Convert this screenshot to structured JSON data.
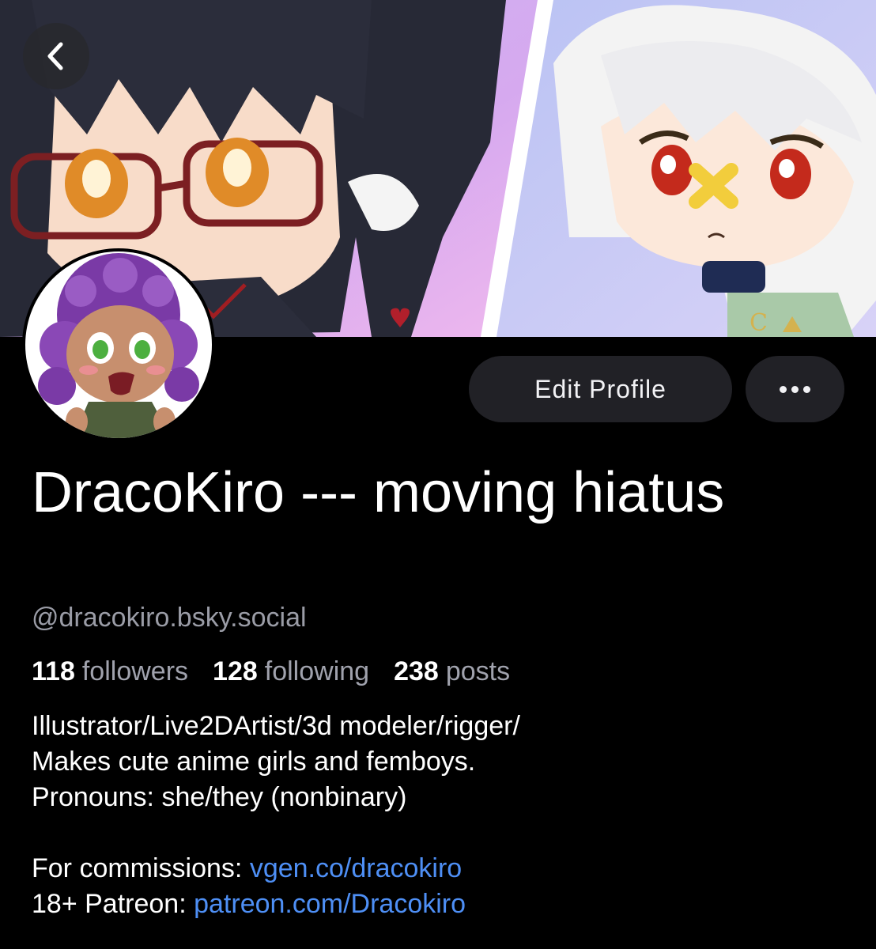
{
  "header": {
    "back_icon": "chevron-left-icon"
  },
  "actions": {
    "edit_profile_label": "Edit Profile",
    "more_icon": "ellipsis-icon"
  },
  "profile": {
    "display_name": "DracoKiro --- moving hiatus",
    "handle": "@dracokiro.bsky.social",
    "stats": {
      "followers_count": "118",
      "followers_label": "followers",
      "following_count": "128",
      "following_label": "following",
      "posts_count": "238",
      "posts_label": "posts"
    },
    "bio": {
      "line1": "Illustrator/Live2DArtist/3d modeler/rigger/",
      "line2": "Makes cute anime girls and femboys.",
      "line3": "Pronouns: she/they (nonbinary)",
      "commissions_label": "For commissions: ",
      "commissions_link": "vgen.co/dracokiro",
      "patreon_label": "18+ Patreon: ",
      "patreon_link": "patreon.com/Dracokiro"
    }
  },
  "colors": {
    "background": "#000000",
    "link": "#4e8ff5",
    "muted_text": "#9a9ca6",
    "button_bg": "#212126"
  }
}
